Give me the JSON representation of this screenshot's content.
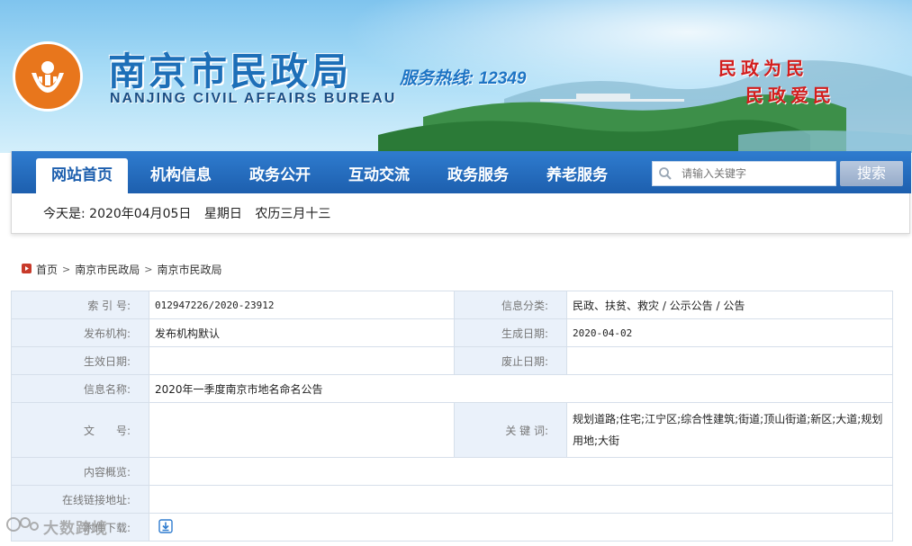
{
  "header": {
    "title_cn": "南京市民政局",
    "title_en": "NANJING CIVIL AFFAIRS BUREAU",
    "hotline": "服务热线: 12349",
    "slogan_1": "民政为民",
    "slogan_2": "民政爱民",
    "logo_icon": "civil-affairs-emblem-icon",
    "brand_color": "#1d6fb8",
    "slogan_color": "#d21e1e"
  },
  "nav": {
    "items": [
      {
        "label": "网站首页",
        "active": true
      },
      {
        "label": "机构信息",
        "active": false
      },
      {
        "label": "政务公开",
        "active": false
      },
      {
        "label": "互动交流",
        "active": false
      },
      {
        "label": "政务服务",
        "active": false
      },
      {
        "label": "养老服务",
        "active": false
      }
    ],
    "search_placeholder": "请输入关键字",
    "search_button": "搜索",
    "nav_color": "#1d5fae"
  },
  "date_line": {
    "today": "今天是: 2020年04月05日",
    "weekday": "星期日",
    "lunar": "农历三月十三"
  },
  "breadcrumb": [
    "首页",
    "南京市民政局",
    "南京市民政局"
  ],
  "info": {
    "index_label": "索 引 号:",
    "index_value": "012947226/2020-23912",
    "category_label": "信息分类:",
    "category_value": "民政、扶贫、救灾 / 公示公告 / 公告",
    "publisher_label": "发布机构:",
    "publisher_value": "发布机构默认",
    "created_label": "生成日期:",
    "created_value": "2020-04-02",
    "effective_label": "生效日期:",
    "effective_value": "",
    "abolished_label": "废止日期:",
    "abolished_value": "",
    "name_label": "信息名称:",
    "name_value": "2020年一季度南京市地名命名公告",
    "docno_label": "文　　号:",
    "docno_value": "",
    "keywords_label": "关 键 词:",
    "keywords_value": "规划道路;住宅;江宁区;综合性建筑;街道;顶山街道;新区;大道;规划用地;大街",
    "summary_label": "内容概览:",
    "summary_value": "",
    "link_label": "在线链接地址:",
    "link_value": "",
    "attach_label": "附件下载:"
  },
  "watermark": "大数跨境"
}
